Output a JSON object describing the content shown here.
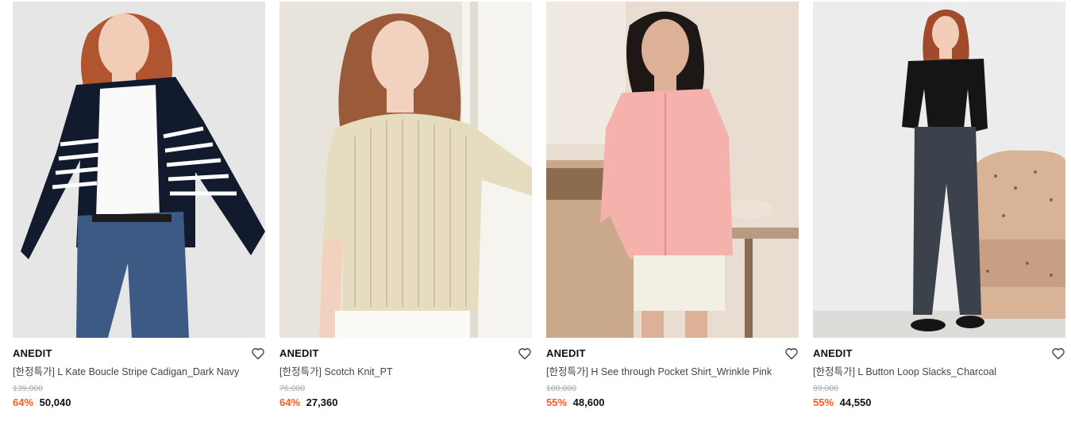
{
  "theme": {
    "discount_color": "#ff5a1f",
    "text_color": "#111111",
    "muted_color": "#aaaaaa"
  },
  "products": [
    {
      "brand": "ANEDIT",
      "name": "[한정특가] L Kate Boucle Stripe Cadigan_Dark Navy",
      "original_price": "139,000",
      "discount": "64%",
      "price": "50,040",
      "image": "model-navy-striped-cardigan-photo",
      "wishlist_icon": "heart-outline-icon"
    },
    {
      "brand": "ANEDIT",
      "name": "[한정특가] Scotch Knit_PT",
      "original_price": "76,000",
      "discount": "64%",
      "price": "27,360",
      "image": "model-beige-pointelle-knit-photo",
      "wishlist_icon": "heart-outline-icon"
    },
    {
      "brand": "ANEDIT",
      "name": "[한정특가] H See through Pocket Shirt_Wrinkle Pink",
      "original_price": "108,000",
      "discount": "55%",
      "price": "48,600",
      "image": "model-pink-sheer-shirt-photo",
      "wishlist_icon": "heart-outline-icon"
    },
    {
      "brand": "ANEDIT",
      "name": "[한정특가] L Button Loop Slacks_Charcoal",
      "original_price": "99,000",
      "discount": "55%",
      "price": "44,550",
      "image": "model-charcoal-slacks-photo",
      "wishlist_icon": "heart-outline-icon"
    }
  ]
}
